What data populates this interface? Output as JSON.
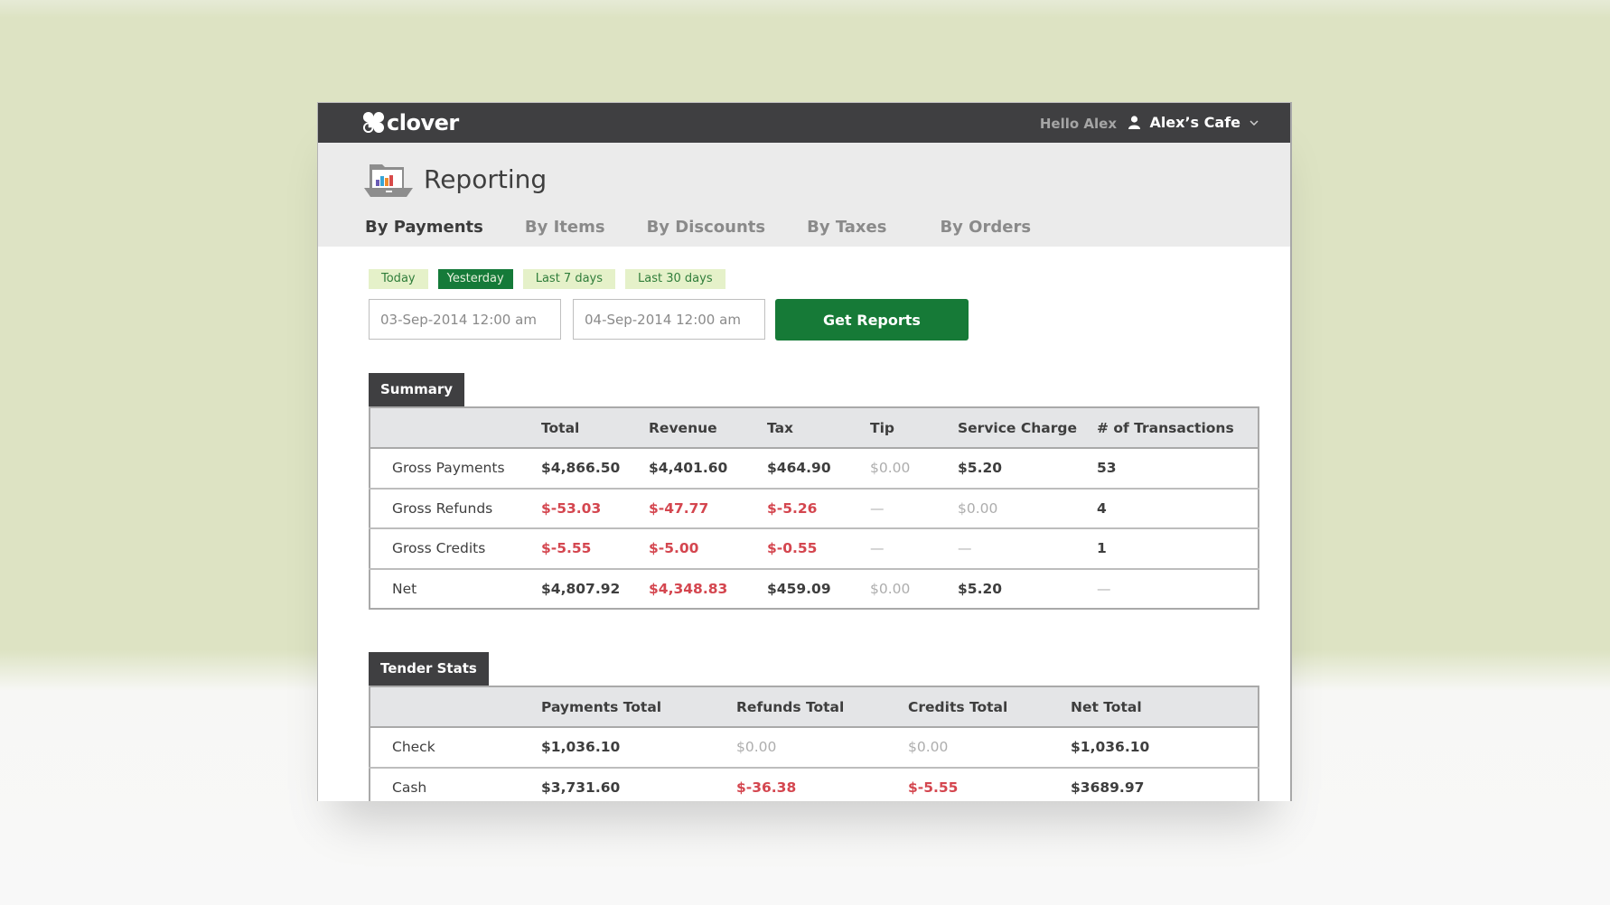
{
  "header": {
    "brand": "clover",
    "greeting": "Hello Alex",
    "account_name": "Alex’s Cafe"
  },
  "page": {
    "title": "Reporting",
    "tabs": [
      {
        "label": "By Payments",
        "active": true
      },
      {
        "label": "By Items",
        "active": false
      },
      {
        "label": "By Discounts",
        "active": false
      },
      {
        "label": "By Taxes",
        "active": false
      },
      {
        "label": "By Orders",
        "active": false
      }
    ]
  },
  "filters": {
    "ranges": [
      {
        "label": "Today",
        "active": false
      },
      {
        "label": "Yesterday",
        "active": true
      },
      {
        "label": "Last 7 days",
        "active": false
      },
      {
        "label": "Last 30 days",
        "active": false
      }
    ],
    "date_from": "03-Sep-2014 12:00 am",
    "date_to": "04-Sep-2014 12:00 am",
    "submit_label": "Get Reports"
  },
  "summary": {
    "label": "Summary",
    "columns": [
      "",
      "Total",
      "Revenue",
      "Tax",
      "Tip",
      "Service Charge",
      "# of Transactions"
    ],
    "rows": [
      {
        "label": "Gross Payments",
        "cells": [
          "$4,866.50",
          "$4,401.60",
          "$464.90",
          "$0.00",
          "$5.20",
          "53"
        ],
        "styles": [
          "",
          "",
          "",
          "muted",
          "",
          ""
        ]
      },
      {
        "label": "Gross Refunds",
        "cells": [
          "$-53.03",
          "$-47.77",
          "$-5.26",
          "—",
          "$0.00",
          "4"
        ],
        "styles": [
          "neg",
          "neg",
          "neg",
          "dash",
          "muted",
          ""
        ]
      },
      {
        "label": "Gross Credits",
        "cells": [
          "$-5.55",
          "$-5.00",
          "$-0.55",
          "—",
          "—",
          "1"
        ],
        "styles": [
          "neg",
          "neg",
          "neg",
          "dash",
          "dash",
          ""
        ]
      },
      {
        "label": "Net",
        "cells": [
          "$4,807.92",
          "$4,348.83",
          "$459.09",
          "$0.00",
          "$5.20",
          "—"
        ],
        "styles": [
          "",
          "neg",
          "",
          "muted",
          "",
          "dash"
        ]
      }
    ]
  },
  "tender_stats": {
    "label": "Tender Stats",
    "columns": [
      "",
      "Payments Total",
      "Refunds Total",
      "Credits Total",
      "Net Total"
    ],
    "rows": [
      {
        "label": "Check",
        "cells": [
          "$1,036.10",
          "$0.00",
          "$0.00",
          "$1,036.10"
        ],
        "styles": [
          "",
          "muted",
          "muted",
          ""
        ]
      },
      {
        "label": "Cash",
        "cells": [
          "$3,731.60",
          "$-36.38",
          "$-5.55",
          "$3689.97"
        ],
        "styles": [
          "",
          "neg",
          "neg",
          ""
        ]
      }
    ]
  },
  "colors": {
    "brand_green": "#167a37",
    "chip_bg": "#e5f1c9",
    "negative": "#d4464f",
    "topbar": "#3f3f41"
  }
}
